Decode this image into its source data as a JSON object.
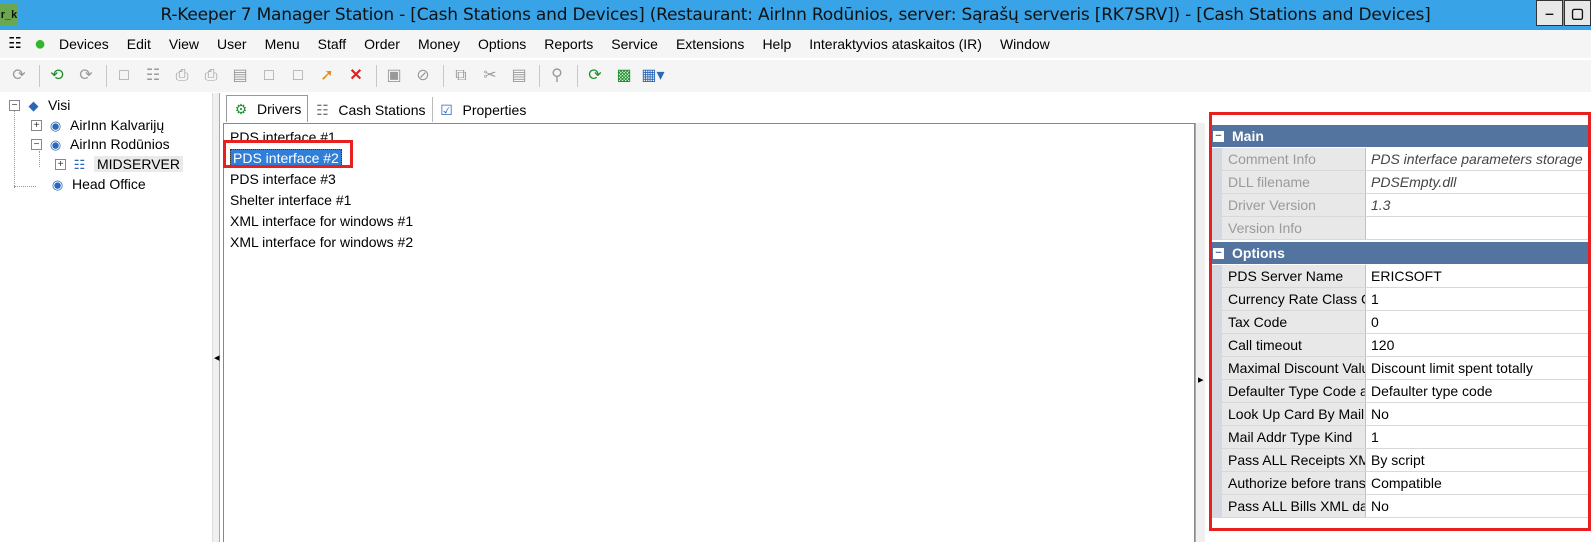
{
  "window": {
    "app_icon": "r_k",
    "title": "R-Keeper 7 Manager Station - [Cash Stations and Devices] (Restaurant: AirInn Rodūnios, server: Sąrašų serveris [RK7SRV]) - [Cash Stations and Devices]",
    "minimize": "‒",
    "maximize": "▢"
  },
  "menu": [
    "Devices",
    "Edit",
    "View",
    "User",
    "Menu",
    "Staff",
    "Order",
    "Money",
    "Options",
    "Reports",
    "Service",
    "Extensions",
    "Help",
    "Interaktyvios ataskaitos (IR)",
    "Window"
  ],
  "tree": {
    "root": "Visi",
    "nodes": [
      "AirInn Kalvarijų",
      "AirInn Rodūnios",
      "MIDSERVER",
      "Head Office"
    ]
  },
  "tabs": [
    "Drivers",
    "Cash Stations",
    "Properties"
  ],
  "drivers": [
    "PDS interface #1",
    "PDS interface #2",
    "PDS interface #3",
    "Shelter interface #1",
    "XML interface for windows #1",
    "XML interface for windows #2"
  ],
  "selected_driver": "PDS interface #2",
  "properties": {
    "main_label": "Main",
    "main": [
      {
        "name": "Comment Info",
        "value": "PDS interface parameters storage"
      },
      {
        "name": "DLL filename",
        "value": "PDSEmpty.dll"
      },
      {
        "name": "Driver Version",
        "value": "1.3"
      },
      {
        "name": "Version Info",
        "value": ""
      }
    ],
    "options_label": "Options",
    "options": [
      {
        "name": "PDS Server Name",
        "value": "ERICSOFT"
      },
      {
        "name": "Currency Rate Class Co",
        "value": "1"
      },
      {
        "name": "Tax Code",
        "value": "0"
      },
      {
        "name": "Call timeout",
        "value": "120"
      },
      {
        "name": "Maximal Discount Value",
        "value": "Discount limit spent totally"
      },
      {
        "name": "Defaulter Type Code as",
        "value": "Defaulter type code"
      },
      {
        "name": "Look Up Card By Mail A",
        "value": "No"
      },
      {
        "name": "Mail Addr Type Kind",
        "value": "1"
      },
      {
        "name": "Pass ALL Receipts XM",
        "value": "By script"
      },
      {
        "name": "Authorize before transa",
        "value": "Compatible"
      },
      {
        "name": "Pass ALL Bills XML dat",
        "value": "No"
      }
    ]
  },
  "colors": {
    "titlebar": "#38a3e6",
    "category_header": "#52749e",
    "selection": "#2f7ed8",
    "highlight": "#e82020"
  }
}
